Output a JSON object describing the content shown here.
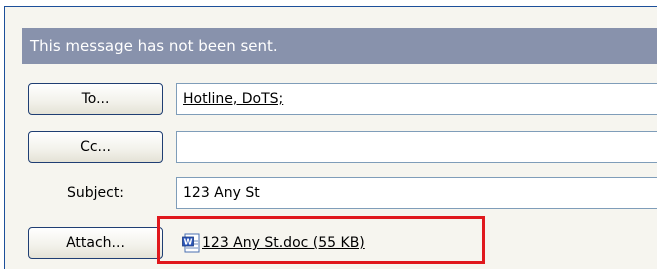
{
  "banner": {
    "text": "This message has not been sent."
  },
  "buttons": {
    "to": "To...",
    "cc": "Cc...",
    "attach": "Attach..."
  },
  "fields": {
    "to_value": "Hotline, DoTS;",
    "cc_value": "",
    "subject_label": "Subject:",
    "subject_value": "123 Any St"
  },
  "attachment": {
    "name": "123 Any St.doc (55 KB)",
    "icon": "word-document-icon"
  },
  "colors": {
    "banner": "#8892ac",
    "highlight": "#e0181d",
    "frame_border": "#1c4f9a"
  }
}
